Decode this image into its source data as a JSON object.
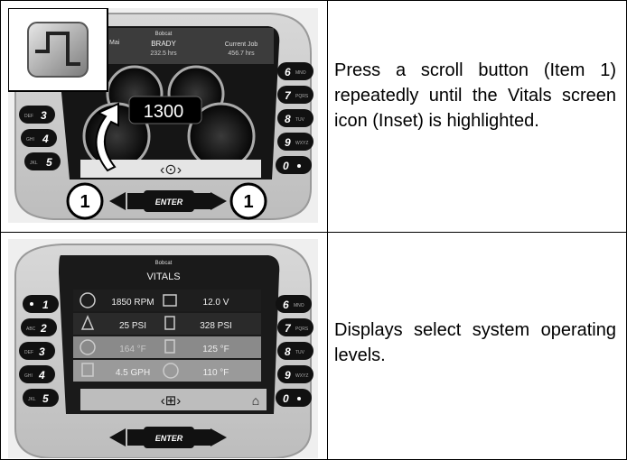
{
  "row1": {
    "instruction": "Press a scroll button (Item 1) repeatedly until the Vitals screen icon (Inset) is highlighted.",
    "display": {
      "brand": "Bobcat",
      "left_label": "Mai",
      "owner": "BRADY",
      "hours": "232.5 hrs",
      "job_label": "Current Job",
      "job_hours": "456.7 hrs",
      "rpm": "1300",
      "enter": "ENTER",
      "callout_left": "1",
      "callout_right": "1",
      "left_keys": [
        "3",
        "4",
        "5"
      ],
      "left_key_labels": [
        "DEF",
        "GHI",
        "JKL"
      ],
      "right_keys": [
        "6",
        "7",
        "8",
        "9",
        "0"
      ],
      "right_key_labels": [
        "MNO",
        "PQRS",
        "TUV",
        "WXYZ",
        ""
      ]
    }
  },
  "row2": {
    "instruction": "Displays select system operating levels.",
    "display": {
      "brand": "Bobcat",
      "title": "VITALS",
      "rows": [
        {
          "left": "1850 RPM",
          "right": "12.0 V"
        },
        {
          "left": "25 PSI",
          "right": "328 PSI"
        },
        {
          "left": "164 °F",
          "right": "125 °F"
        },
        {
          "left": "4.5 GPH",
          "right": "110 °F"
        }
      ],
      "enter": "ENTER",
      "left_keys": [
        "1",
        "2",
        "3",
        "4",
        "5"
      ],
      "left_key_labels": [
        "",
        "ABC",
        "DEF",
        "GHI",
        "JKL"
      ],
      "right_keys": [
        "6",
        "7",
        "8",
        "9",
        "0"
      ],
      "right_key_labels": [
        "MNO",
        "PQRS",
        "TUV",
        "WXYZ",
        ""
      ]
    }
  }
}
